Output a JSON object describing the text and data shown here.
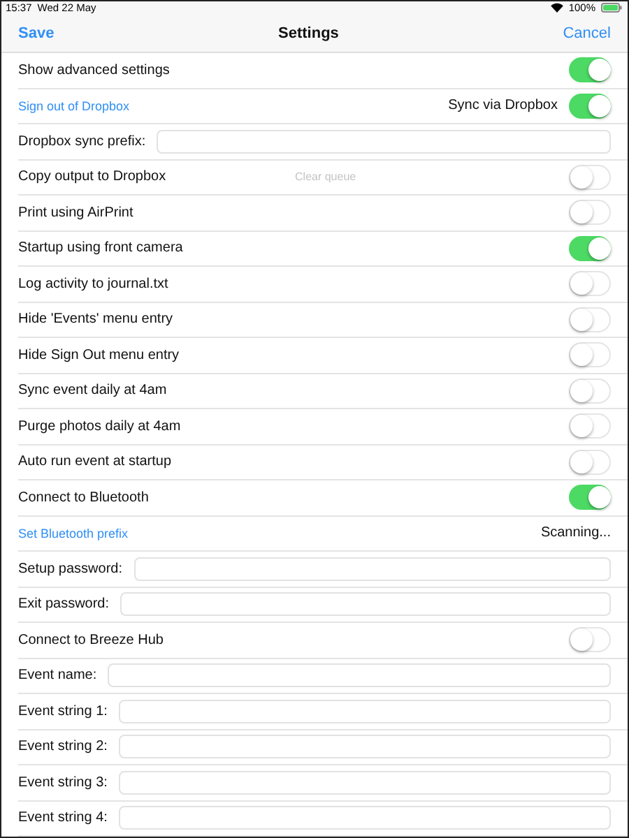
{
  "status_bar": {
    "time": "15:37",
    "date": "Wed 22 May",
    "battery": "100%"
  },
  "nav": {
    "left": "Save",
    "title": "Settings",
    "right": "Cancel"
  },
  "rows": [
    {
      "kind": "toggle",
      "label": "Show advanced settings",
      "on": true
    },
    {
      "kind": "link_toggle",
      "link": "Sign out of Dropbox",
      "label": "Sync via Dropbox",
      "on": true
    },
    {
      "kind": "field",
      "label": "Dropbox sync prefix:"
    },
    {
      "kind": "action_toggle",
      "label": "Copy output to Dropbox",
      "action": "Clear queue",
      "action_disabled": true,
      "on": false
    },
    {
      "kind": "toggle",
      "label": "Print using AirPrint",
      "on": false
    },
    {
      "kind": "toggle",
      "label": "Startup using front camera",
      "on": true
    },
    {
      "kind": "toggle",
      "label": "Log activity to journal.txt",
      "on": false
    },
    {
      "kind": "toggle",
      "label": "Hide 'Events' menu entry",
      "on": false
    },
    {
      "kind": "toggle",
      "label": "Hide Sign Out menu entry",
      "on": false
    },
    {
      "kind": "toggle",
      "label": "Sync event daily at 4am",
      "on": false
    },
    {
      "kind": "toggle",
      "label": "Purge photos daily at 4am",
      "on": false
    },
    {
      "kind": "toggle",
      "label": "Auto run event at startup",
      "on": false
    },
    {
      "kind": "toggle",
      "label": "Connect to Bluetooth",
      "on": true
    },
    {
      "kind": "link_status",
      "link": "Set Bluetooth prefix",
      "status": "Scanning..."
    },
    {
      "kind": "field",
      "label": "Setup password:"
    },
    {
      "kind": "field",
      "label": "Exit password:"
    },
    {
      "kind": "toggle",
      "label": "Connect to Breeze Hub",
      "on": false
    },
    {
      "kind": "field",
      "label": "Event name:"
    },
    {
      "kind": "field",
      "label": "Event string 1:"
    },
    {
      "kind": "field",
      "label": "Event string 2:"
    },
    {
      "kind": "field",
      "label": "Event string 3:"
    },
    {
      "kind": "field",
      "label": "Event string 4:"
    }
  ]
}
